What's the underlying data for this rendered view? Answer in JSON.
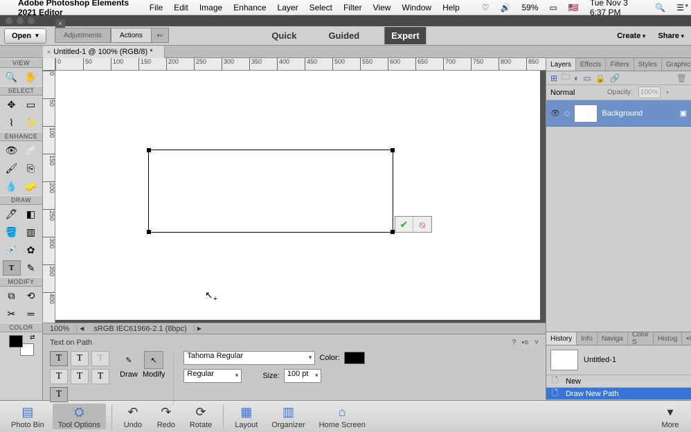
{
  "mac": {
    "app": "Adobe Photoshop Elements 2021 Editor",
    "menus": [
      "File",
      "Edit",
      "Image",
      "Enhance",
      "Layer",
      "Select",
      "Filter",
      "View",
      "Window",
      "Help"
    ],
    "battery": "59%",
    "clock": "Tue Nov 3  6:37 PM"
  },
  "appbar": {
    "open": "Open",
    "subtabs": [
      "Adjustments",
      "Actions"
    ],
    "modes": {
      "quick": "Quick",
      "guided": "Guided",
      "expert": "Expert"
    },
    "create": "Create",
    "share": "Share"
  },
  "doc": {
    "title": "Untitled-1 @ 100% (RGB/8) *"
  },
  "toolcats": {
    "view": "VIEW",
    "select": "SELECT",
    "enhance": "ENHANCE",
    "draw": "DRAW",
    "modify": "MODIFY",
    "color": "COLOR"
  },
  "ruler": {
    "h": [
      "0",
      "50",
      "100",
      "150",
      "200",
      "250",
      "300",
      "350",
      "400",
      "450",
      "500",
      "550",
      "600",
      "650",
      "700",
      "750",
      "800",
      "850"
    ],
    "v": [
      "0",
      "50",
      "100",
      "150",
      "200",
      "250",
      "300",
      "350",
      "400"
    ]
  },
  "status": {
    "zoom": "100%",
    "profile": "sRGB IEC61966-2.1 (8bpc)"
  },
  "opt": {
    "title": "Text on Path",
    "draw": "Draw",
    "modify": "Modify",
    "font": "Tahoma Regular",
    "weight": "Regular",
    "sizelbl": "Size:",
    "size": "100 pt",
    "colorlbl": "Color:"
  },
  "layers": {
    "tabs": [
      "Layers",
      "Effects",
      "Filters",
      "Styles",
      "Graphics"
    ],
    "blend": "Normal",
    "opacitylbl": "Opacity:",
    "opacity": "100%",
    "rows": [
      {
        "name": "Background"
      }
    ]
  },
  "history": {
    "tabs": [
      "History",
      "Info",
      "Navigator",
      "Color Swatches",
      "Histogram"
    ],
    "doc": "Untitled-1",
    "items": [
      {
        "name": "New"
      },
      {
        "name": "Draw New Path"
      }
    ]
  },
  "bottom": {
    "photobin": "Photo Bin",
    "toolopts": "Tool Options",
    "undo": "Undo",
    "redo": "Redo",
    "rotate": "Rotate",
    "layout": "Layout",
    "organizer": "Organizer",
    "home": "Home Screen",
    "more": "More"
  }
}
